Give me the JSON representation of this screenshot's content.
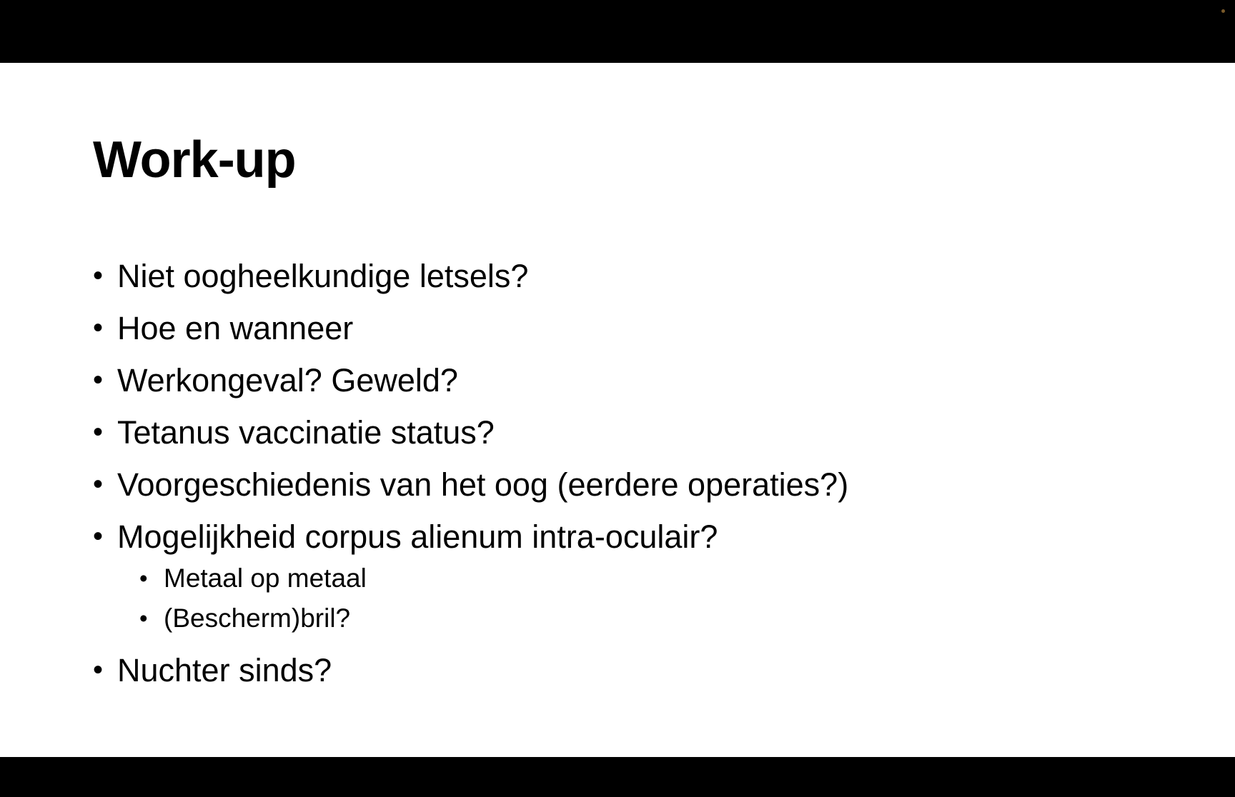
{
  "slide": {
    "title": "Work-up",
    "bullets": [
      {
        "text": "Niet oogheelkundige letsels?"
      },
      {
        "text": "Hoe en wanneer"
      },
      {
        "text": "Werkongeval? Geweld?"
      },
      {
        "text": "Tetanus vaccinatie status?"
      },
      {
        "text": "Voorgeschiedenis van het oog (eerdere operaties?)"
      },
      {
        "text": "Mogelijkheid corpus alienum intra-oculair?",
        "sub": [
          "Metaal op metaal",
          "(Bescherm)bril?"
        ]
      },
      {
        "text": "Nuchter sinds?"
      }
    ],
    "bullet_char": "•",
    "colors": {
      "background": "#ffffff",
      "text": "#000000",
      "frame": "#000000"
    }
  }
}
